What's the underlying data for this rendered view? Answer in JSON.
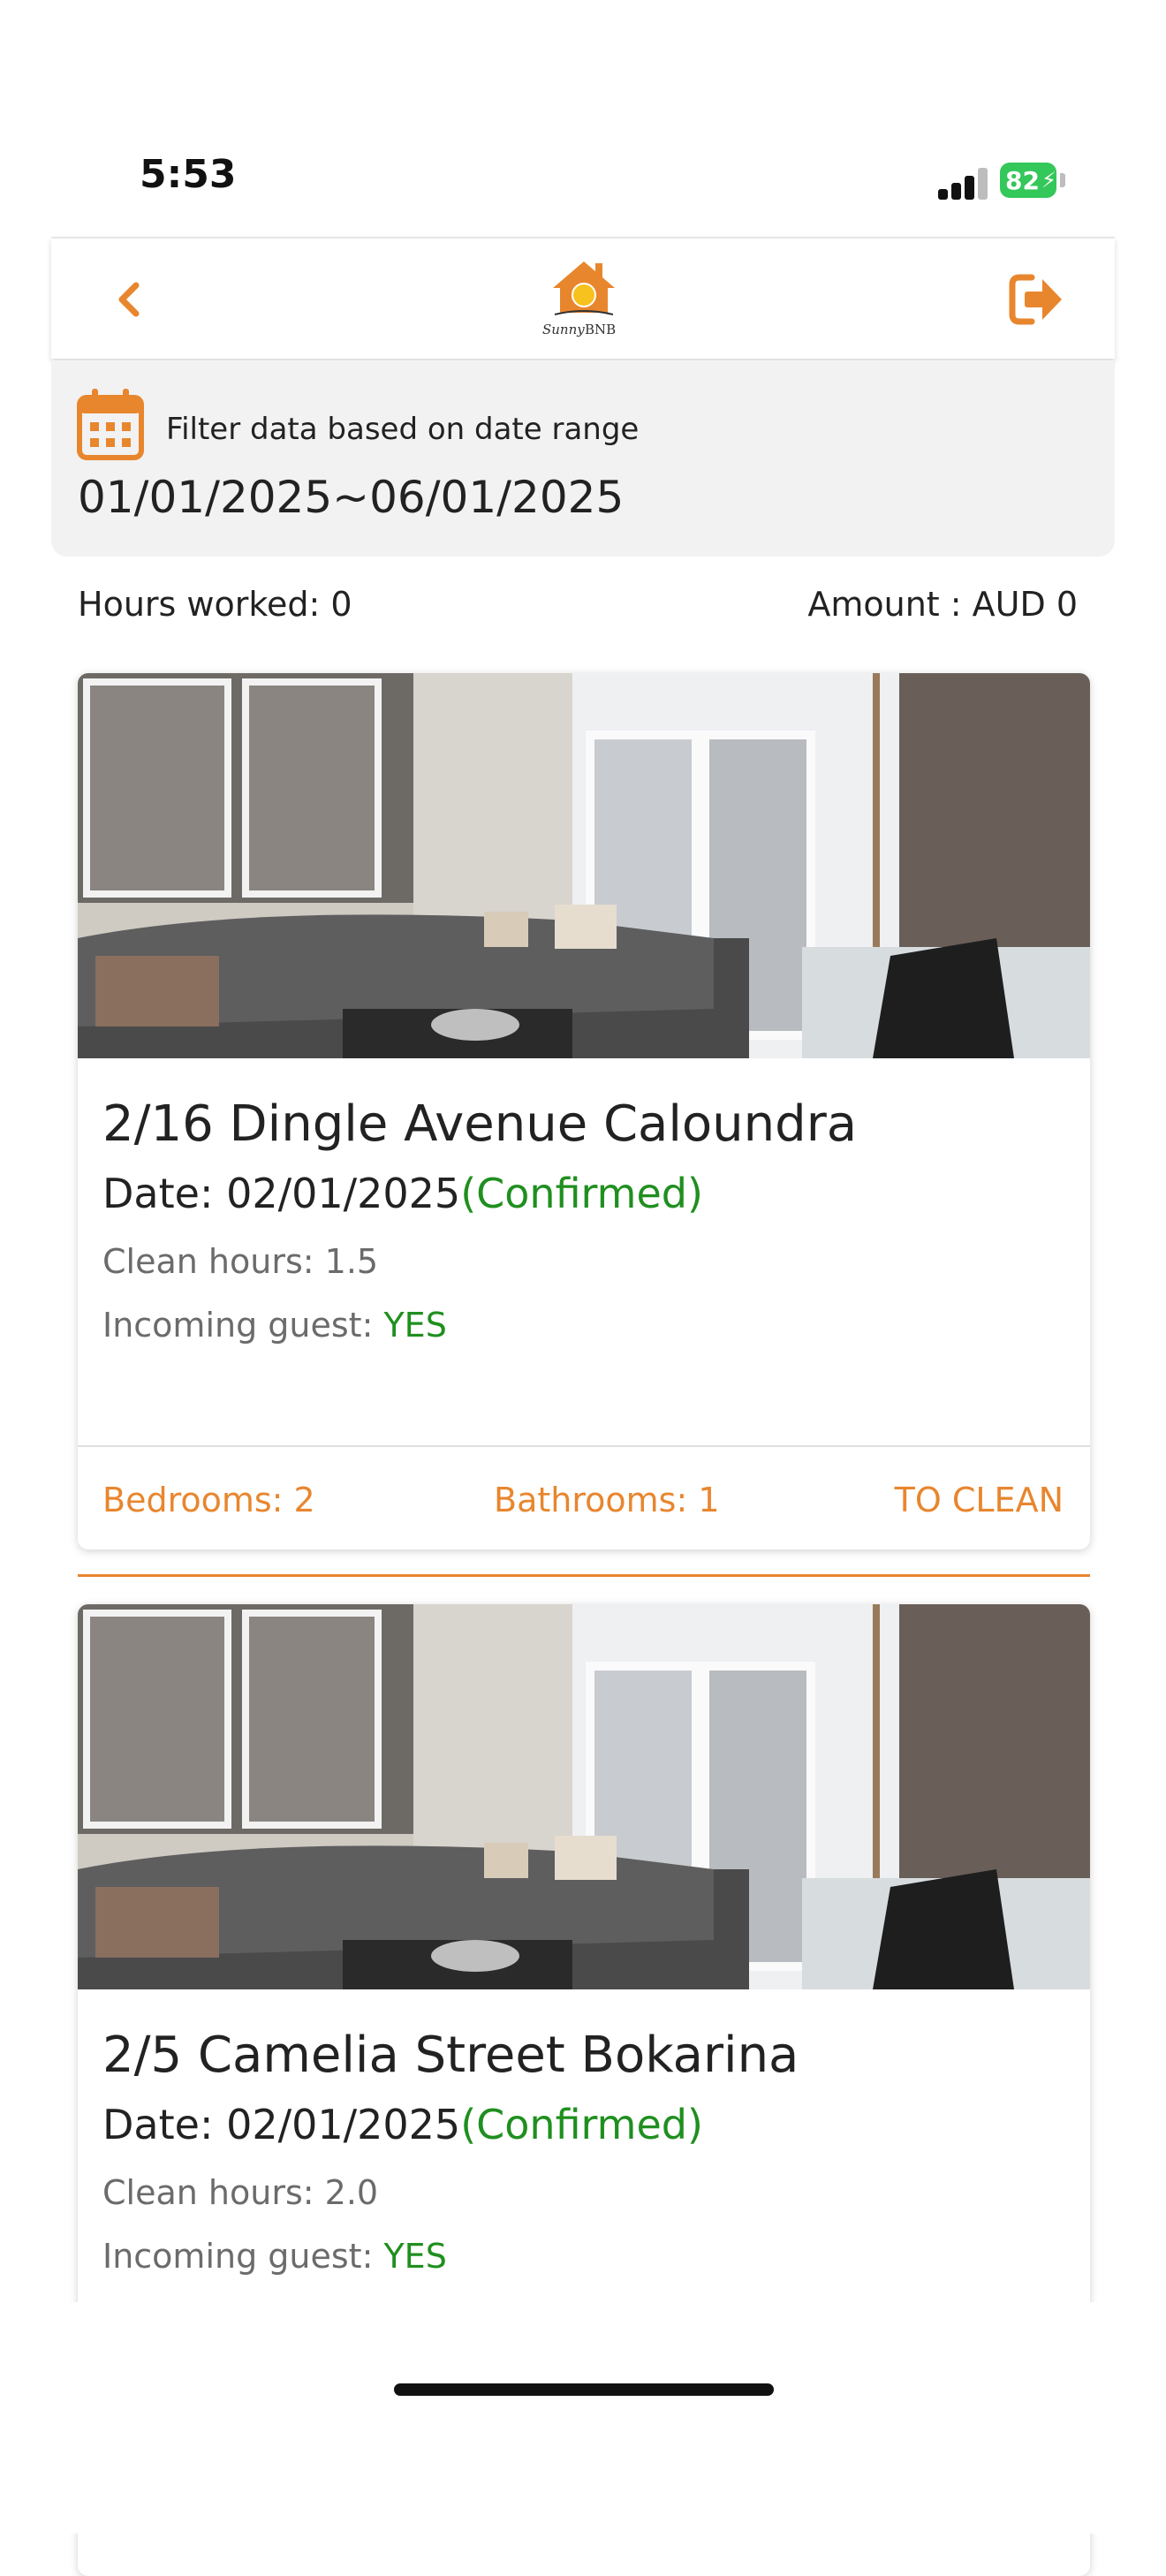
{
  "status_bar": {
    "time": "5:53",
    "battery": "82"
  },
  "header": {
    "logo_text": "SunnyBNB",
    "accent_color": "#e8862e"
  },
  "filter": {
    "label": "Filter data based on date range",
    "range": "01/01/2025~06/01/2025"
  },
  "summary": {
    "hours_worked": "Hours worked: 0",
    "amount": "Amount : AUD 0"
  },
  "jobs": [
    {
      "title": "2/16 Dingle Avenue Caloundra",
      "date": "Date: 02/01/2025",
      "status": "(Confirmed)",
      "clean_hours": "Clean hours: 1.5",
      "incoming_guest_label": "Incoming guest: ",
      "incoming_guest_value": "YES",
      "bedrooms": "Bedrooms: 2",
      "bathrooms": "Bathrooms: 1",
      "action": "TO CLEAN"
    },
    {
      "title": "2/5 Camelia Street Bokarina",
      "date": "Date: 02/01/2025",
      "status": "(Confirmed)",
      "clean_hours": "Clean hours: 2.0",
      "incoming_guest_label": "Incoming guest: ",
      "incoming_guest_value": "YES"
    }
  ]
}
